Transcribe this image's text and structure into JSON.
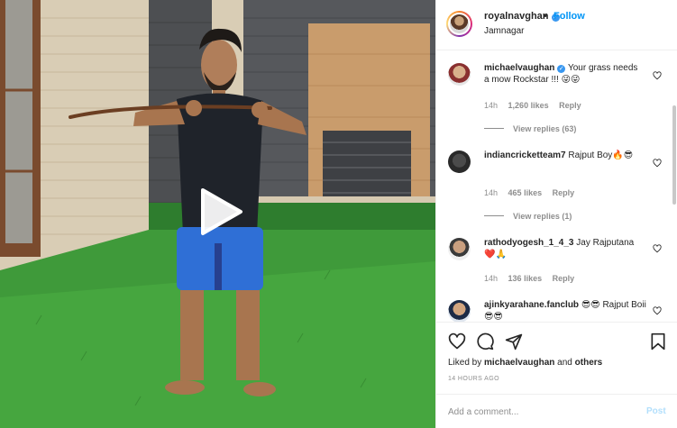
{
  "post": {
    "username": "royalnavghan",
    "separator": "•",
    "follow_label": "Follow",
    "location": "Jamnagar",
    "more_label": "•••"
  },
  "comments": [
    {
      "username": "michaelvaughan",
      "verified": true,
      "text": "Your grass needs a mow Rockstar !!! 😜😜",
      "time": "14h",
      "likes": "1,260 likes",
      "reply_label": "Reply",
      "view_replies": "View replies (63)"
    },
    {
      "username": "indiancricketteam7",
      "verified": false,
      "text": "Rajput Boy🔥😎",
      "time": "14h",
      "likes": "465 likes",
      "reply_label": "Reply",
      "view_replies": "View replies (1)"
    },
    {
      "username": "rathodyogesh_1_4_3",
      "verified": false,
      "text": "Jay Rajputana ❤️🙏",
      "time": "14h",
      "likes": "136 likes",
      "reply_label": "Reply"
    },
    {
      "username": "ajinkyarahane.fanclub",
      "verified": false,
      "text": "😎😎 Rajput Boii 😎😎"
    }
  ],
  "actions": {
    "liked_by_prefix": "Liked by",
    "liked_by_user": "michaelvaughan",
    "liked_by_and": "and",
    "liked_by_others": "others",
    "time_ago": "14 HOURS AGO"
  },
  "add_comment": {
    "placeholder": "Add a comment...",
    "post_label": "Post"
  },
  "icons": {
    "play": "play-icon",
    "verified": "verified-badge-icon",
    "heart": "heart-icon",
    "comment": "comment-icon",
    "share": "paper-plane-icon",
    "save": "bookmark-icon"
  },
  "colors": {
    "link_blue": "#0095f6",
    "post_disabled": "#b2dffc",
    "muted_text": "#8e8e8e",
    "grass": "#3a8a3a"
  }
}
